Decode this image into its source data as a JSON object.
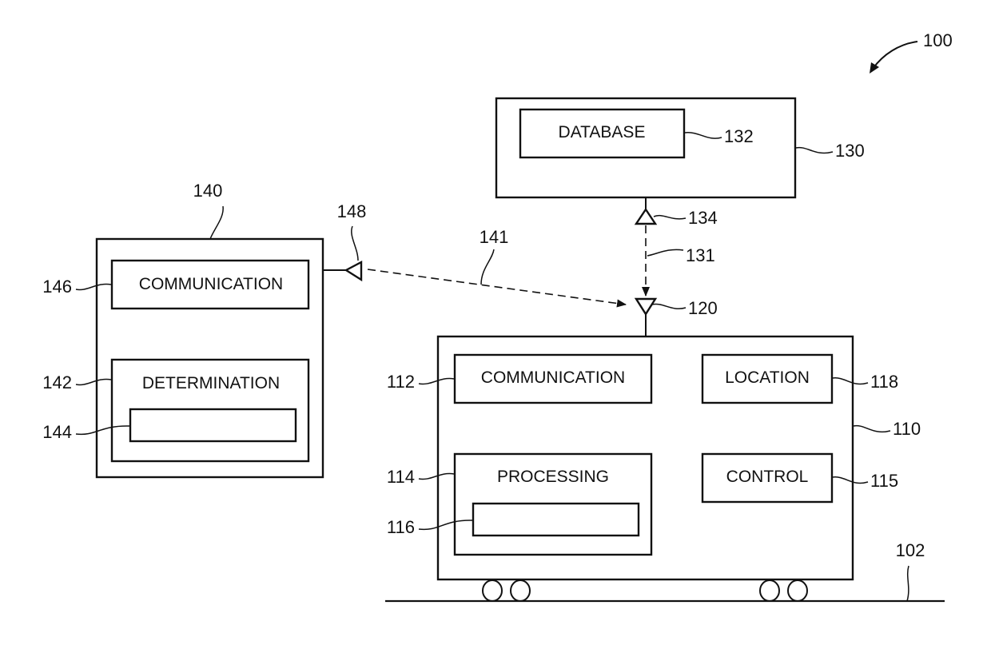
{
  "figure": {
    "reference": "100",
    "track_ref": "102"
  },
  "server": {
    "ref": "130",
    "database": {
      "label": "DATABASE",
      "ref": "132"
    },
    "antenna_ref": "134",
    "link_ref": "131"
  },
  "remote_device": {
    "ref": "140",
    "communication": {
      "label": "COMMUNICATION",
      "ref": "146"
    },
    "determination": {
      "label": "DETERMINATION",
      "ref": "142",
      "inner_ref": "144"
    },
    "antenna_ref": "148",
    "link_ref": "141"
  },
  "vehicle": {
    "ref": "110",
    "antenna_ref": "120",
    "communication": {
      "label": "COMMUNICATION",
      "ref": "112"
    },
    "location": {
      "label": "LOCATION",
      "ref": "118"
    },
    "processing": {
      "label": "PROCESSING",
      "ref": "114",
      "inner_ref": "116"
    },
    "control": {
      "label": "CONTROL",
      "ref": "115"
    }
  }
}
